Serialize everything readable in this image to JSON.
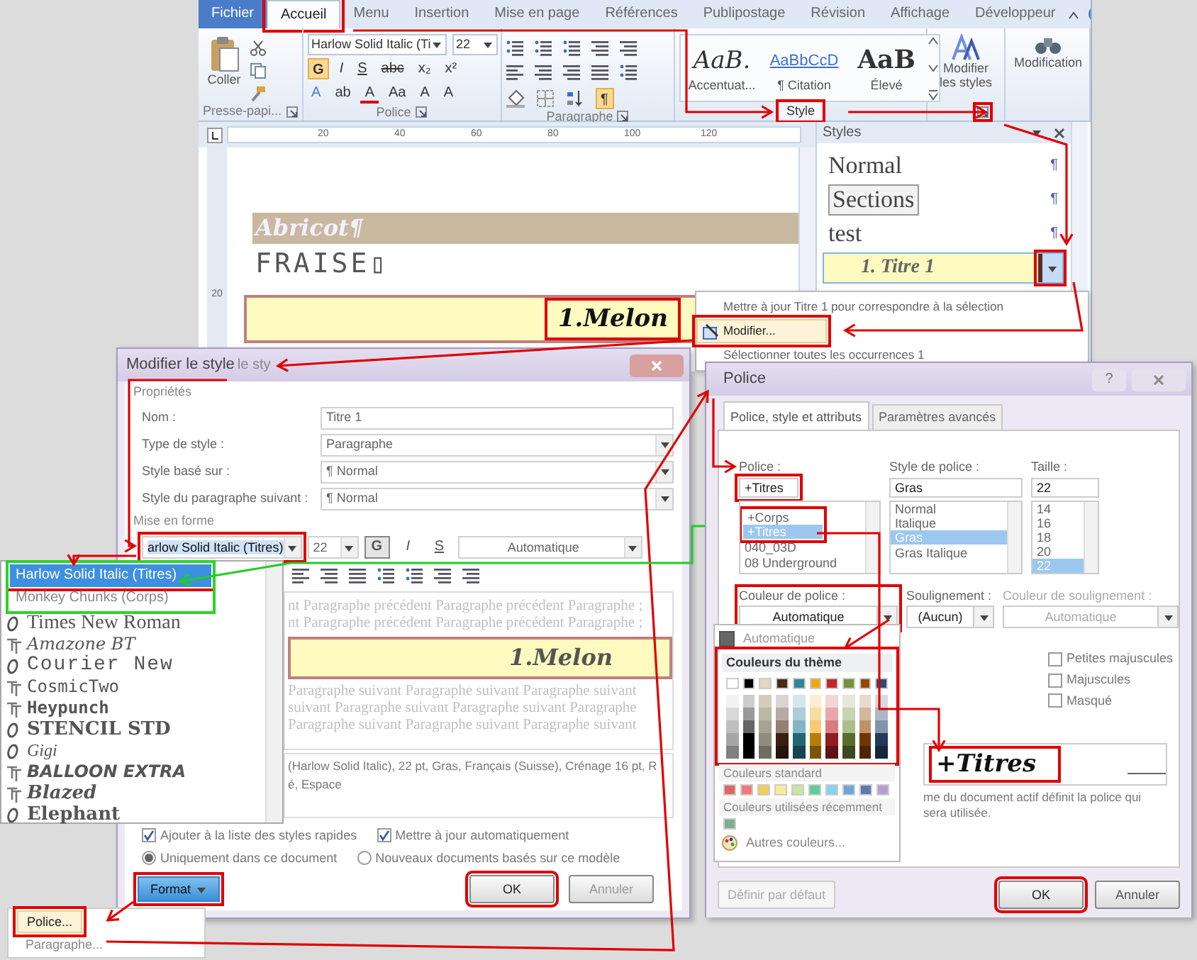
{
  "word": {
    "tabs": [
      {
        "label": "Fichier",
        "kind": "file",
        "selected": false
      },
      {
        "label": "Accueil",
        "kind": "tab",
        "selected": true,
        "framed": true
      },
      {
        "label": "Menu",
        "kind": "tab",
        "selected": false
      },
      {
        "label": "Insertion",
        "kind": "tab",
        "selected": false
      },
      {
        "label": "Mise en page",
        "kind": "tab",
        "selected": false
      },
      {
        "label": "Références",
        "kind": "tab",
        "selected": false
      },
      {
        "label": "Publipostage",
        "kind": "tab",
        "selected": false
      },
      {
        "label": "Révision",
        "kind": "tab",
        "selected": false
      },
      {
        "label": "Affichage",
        "kind": "tab",
        "selected": false
      },
      {
        "label": "Développeur",
        "kind": "tab",
        "selected": false
      }
    ],
    "clipboard": {
      "paste_label": "Coller",
      "group_label": "Presse-papi..."
    },
    "font": {
      "face": "Harlow Solid Italic (Ti",
      "size": "22",
      "group_label": "Police",
      "row1": [
        {
          "label": "G",
          "on": true
        },
        {
          "label": "I",
          "on": false
        },
        {
          "label": "S",
          "on": false
        },
        {
          "label": "abc",
          "on": false
        },
        {
          "label": "x₂",
          "on": false
        },
        {
          "label": "x²",
          "on": false
        }
      ],
      "row2": [
        {
          "label": "A",
          "on": false
        },
        {
          "label": "ab",
          "on": false
        },
        {
          "label": "A",
          "on": false
        },
        {
          "label": "Aa",
          "on": false
        },
        {
          "label": "A",
          "on": false
        },
        {
          "label": "A",
          "on": false
        }
      ]
    },
    "paragraph": {
      "group_label": "Paragraphe",
      "marks": {
        "label": "¶",
        "on": true
      }
    },
    "styles_gallery": [
      {
        "preview": "AaB.",
        "label": "Accentuat...",
        "kind": "italic"
      },
      {
        "preview": "AaBbCcD",
        "label": "¶ Citation",
        "kind": "link"
      },
      {
        "preview": "AaB",
        "label": "Élevé",
        "kind": "bold"
      }
    ],
    "styles_group": {
      "label": "Style",
      "framed": true
    },
    "styles_launcher": {
      "framed": true
    },
    "change_styles": "Modifier les styles",
    "editing": "Modification",
    "ruler": [
      "20",
      "40",
      "60",
      "80",
      "100",
      "120"
    ],
    "vertical_ruler": [
      "20"
    ],
    "document": [
      {
        "text": "Abricot¶",
        "kind": "abricot"
      },
      {
        "text": "FRAISE▯",
        "kind": "fraise"
      },
      {
        "text": "1.Melon",
        "kind": "melon",
        "framed": true
      }
    ],
    "styles_pane": {
      "title": "Styles",
      "items": [
        {
          "name": "Normal",
          "mark": "¶",
          "kind": "normal",
          "selected": false
        },
        {
          "name": "Sections",
          "mark": "¶",
          "kind": "boxed",
          "selected": false
        },
        {
          "name": "test",
          "mark": "¶",
          "kind": "plain",
          "selected": false
        },
        {
          "name": "1.  Titre 1",
          "kind": "title",
          "selected": true,
          "framed": true
        }
      ]
    },
    "context_menu": [
      {
        "label": "Mettre à jour Titre 1 pour correspondre à la sélection",
        "highlighted": false
      },
      {
        "label": "Modifier...",
        "highlighted": true,
        "framed": true
      },
      {
        "label": "Sélectionner toutes les occurrences 1",
        "highlighted": false
      }
    ]
  },
  "modify_dialog": {
    "title": "Modifier le style",
    "title_ghost": "le sty",
    "properties_label": "Propriétés",
    "fields": [
      {
        "label": "Nom :",
        "value": "Titre 1",
        "kind": "text"
      },
      {
        "label": "Type de style :",
        "value": "Paragraphe",
        "kind": "combo"
      },
      {
        "label": "Style basé sur :",
        "value": "¶ Normal",
        "kind": "combo"
      },
      {
        "label": "Style du paragraphe suivant :",
        "value": "¶ Normal",
        "kind": "combo"
      }
    ],
    "formatting_label": "Mise en forme",
    "font": {
      "value": "arlow Solid Italic (Titres)",
      "framed": true
    },
    "size": "22",
    "styles": [
      {
        "label": "G",
        "on": true
      },
      {
        "label": "I",
        "on": false
      },
      {
        "label": "S",
        "on": false
      }
    ],
    "font_color": "Automatique",
    "preview": {
      "before": [
        "nt Paragraphe précédent Paragraphe précédent Paragraphe ;",
        "nt Paragraphe précédent Paragraphe précédent Paragraphe ;"
      ],
      "sample": "1.Melon",
      "after": [
        "Paragraphe suivant Paragraphe suivant Paragraphe suivant",
        "suivant Paragraphe suivant Paragraphe suivant Paragraphe",
        "Paragraphe suivant Paragraphe suivant Paragraphe suivant"
      ]
    },
    "description": [
      "(Harlow Solid Italic), 22 pt, Gras, Français (Suisse), Crénage 16 pt, R",
      "é, Espace"
    ],
    "checkboxes": [
      {
        "label": "Ajouter à la liste des styles rapides",
        "checked": true
      },
      {
        "label": "Mettre à jour automatiquement",
        "checked": true
      }
    ],
    "radios": [
      {
        "label": "Uniquement dans ce document",
        "selected": true
      },
      {
        "label": "Nouveaux documents basés sur ce modèle",
        "selected": false
      }
    ],
    "format_button": {
      "label": "Format",
      "framed": true
    },
    "ok": {
      "label": "OK",
      "framed": true
    },
    "cancel": "Annuler"
  },
  "font_dropdown": {
    "framed_green": true,
    "theme_fonts": [
      {
        "name": "Harlow Solid Italic (Titres)",
        "selected": true,
        "framed": true
      },
      {
        "name": "Monkey Chunks (Corps)",
        "selected": false
      }
    ],
    "fonts": [
      {
        "name": "Times New Roman",
        "opentype": true,
        "kind": "times"
      },
      {
        "name": "Amazone BT",
        "opentype": false,
        "kind": "script"
      },
      {
        "name": "Courier New",
        "opentype": true,
        "kind": "courier"
      },
      {
        "name": "CosmicTwo",
        "opentype": false,
        "kind": "cosmic"
      },
      {
        "name": "Heypunch",
        "opentype": false,
        "kind": "heypunch"
      },
      {
        "name": "STENCIL STD",
        "opentype": true,
        "kind": "stencil"
      },
      {
        "name": "Gigi",
        "opentype": true,
        "kind": "gigi"
      },
      {
        "name": "BALLOON EXTRA",
        "opentype": false,
        "kind": "balloon"
      },
      {
        "name": "Blazed",
        "opentype": false,
        "kind": "blazed"
      },
      {
        "name": "Elephant",
        "opentype": true,
        "kind": "elephant"
      }
    ]
  },
  "format_menu": [
    {
      "label": "Police...",
      "highlighted": true,
      "framed": true
    },
    {
      "label": "Paragraphe...",
      "highlighted": false
    }
  ],
  "font_dialog": {
    "title": "Police",
    "help": "?",
    "tabs": [
      {
        "label": "Police, style et attributs",
        "selected": true
      },
      {
        "label": "Paramètres avancés",
        "selected": false
      }
    ],
    "font": {
      "label": "Police :",
      "value": "+Titres",
      "framed": true,
      "top_items_framed": true,
      "items": [
        {
          "name": "+Corps",
          "selected": false
        },
        {
          "name": "+Titres",
          "selected": true
        },
        {
          "name": "040_03D",
          "selected": false
        },
        {
          "name": "08 Underground",
          "selected": false
        }
      ]
    },
    "style": {
      "label": "Style de police :",
      "value": "Gras",
      "items": [
        {
          "name": "Normal",
          "selected": false
        },
        {
          "name": "Italique",
          "selected": false
        },
        {
          "name": "Gras",
          "selected": true
        },
        {
          "name": "Gras Italique",
          "selected": false
        }
      ]
    },
    "size": {
      "label": "Taille :",
      "value": "22",
      "items": [
        {
          "name": "14",
          "selected": false
        },
        {
          "name": "16",
          "selected": false
        },
        {
          "name": "18",
          "selected": false
        },
        {
          "name": "20",
          "selected": false
        },
        {
          "name": "22",
          "selected": true
        }
      ]
    },
    "color": {
      "label": "Couleur de police :",
      "value": "Automatique",
      "framed": true
    },
    "underline": {
      "label": "Soulignement :",
      "value": "(Aucun)"
    },
    "underline_color": {
      "label": "Couleur de soulignement :",
      "value": "Automatique",
      "disabled": true
    },
    "effects": [
      {
        "label": "Petites majuscules",
        "checked": false
      },
      {
        "label": "Majuscules",
        "checked": false
      },
      {
        "label": "Masqué",
        "checked": false
      }
    ],
    "preview": {
      "sample": "+Titres",
      "framed": true
    },
    "note": "me du document actif définit la police qui sera utilisée.",
    "default_button": {
      "label": "Définir par défaut",
      "disabled": true
    },
    "ok": {
      "label": "OK",
      "framed": true
    },
    "cancel": "Annuler"
  },
  "color_menu": {
    "automatic": "Automatique",
    "theme_label": "Couleurs du thème",
    "theme_framed": true,
    "theme": [
      {
        "color": "#ffffff"
      },
      {
        "color": "#000000"
      },
      {
        "color": "#ddd9c3"
      },
      {
        "color": "#4b2918"
      },
      {
        "color": "#31859c"
      },
      {
        "color": "#f3a712"
      },
      {
        "color": "#c0262d"
      },
      {
        "color": "#76923c"
      },
      {
        "color": "#974706"
      },
      {
        "color": "#2c4d75"
      }
    ],
    "standard_label": "Couleurs standard",
    "standard": [
      {
        "color": "#e06666"
      },
      {
        "color": "#f07a7a"
      },
      {
        "color": "#f5cc5a"
      },
      {
        "color": "#f7ec9a"
      },
      {
        "color": "#c9e49b"
      },
      {
        "color": "#5fcf97"
      },
      {
        "color": "#85d3f2"
      },
      {
        "color": "#6ea6dc"
      },
      {
        "color": "#6079ad"
      },
      {
        "color": "#b49fd4"
      }
    ],
    "recent_label": "Couleurs utilisées récemment",
    "recent": [
      {
        "color": "#7fae8e"
      }
    ],
    "more": "Autres couleurs..."
  }
}
